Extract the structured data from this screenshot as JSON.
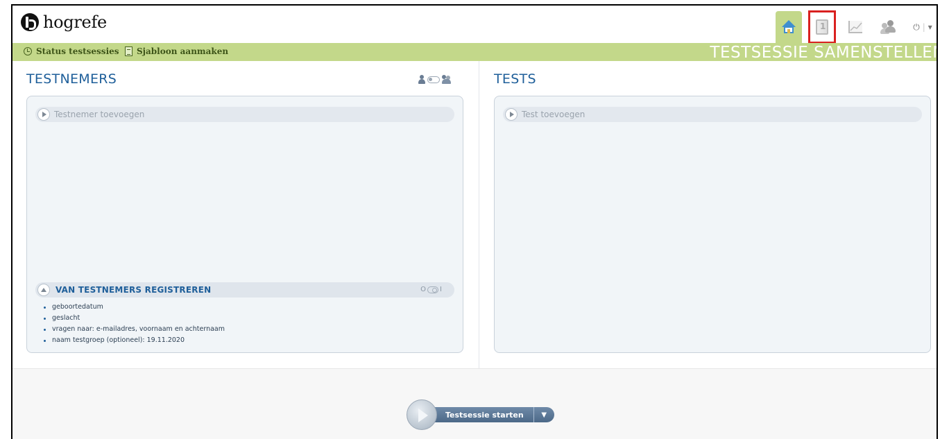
{
  "brand": {
    "name": "hogrefe"
  },
  "nav": {
    "items": [
      {
        "icon": "home-icon",
        "active": true
      },
      {
        "icon": "book-icon",
        "highlighted": true
      },
      {
        "icon": "chart-icon"
      },
      {
        "icon": "users-icon"
      }
    ],
    "power_glyph": "⏻",
    "power_caret": "▾"
  },
  "subbar": {
    "status_link": "Status testsessies",
    "template_link": "Sjabloon aanmaken",
    "page_title": "TESTSESSIE SAMENSTELLEN"
  },
  "testnemers": {
    "title": "TESTNEMERS",
    "add_label": "Testnemer toevoegen",
    "register": {
      "title": "VAN TESTNEMERS REGISTREREN",
      "toggle_off": "O",
      "toggle_on": "I",
      "items": [
        "geboortedatum",
        "geslacht",
        "vragen naar: e-mailadres, voornaam en achternaam",
        "naam testgroep (optioneel): 19.11.2020"
      ]
    }
  },
  "tests": {
    "title": "TESTS",
    "add_label": "Test toevoegen"
  },
  "footer": {
    "start_label": "Testsessie starten",
    "caret": "▼"
  },
  "colors": {
    "accent_green": "#c3d88a",
    "title_blue": "#1f5f9a",
    "highlight_red": "#d9201f"
  }
}
